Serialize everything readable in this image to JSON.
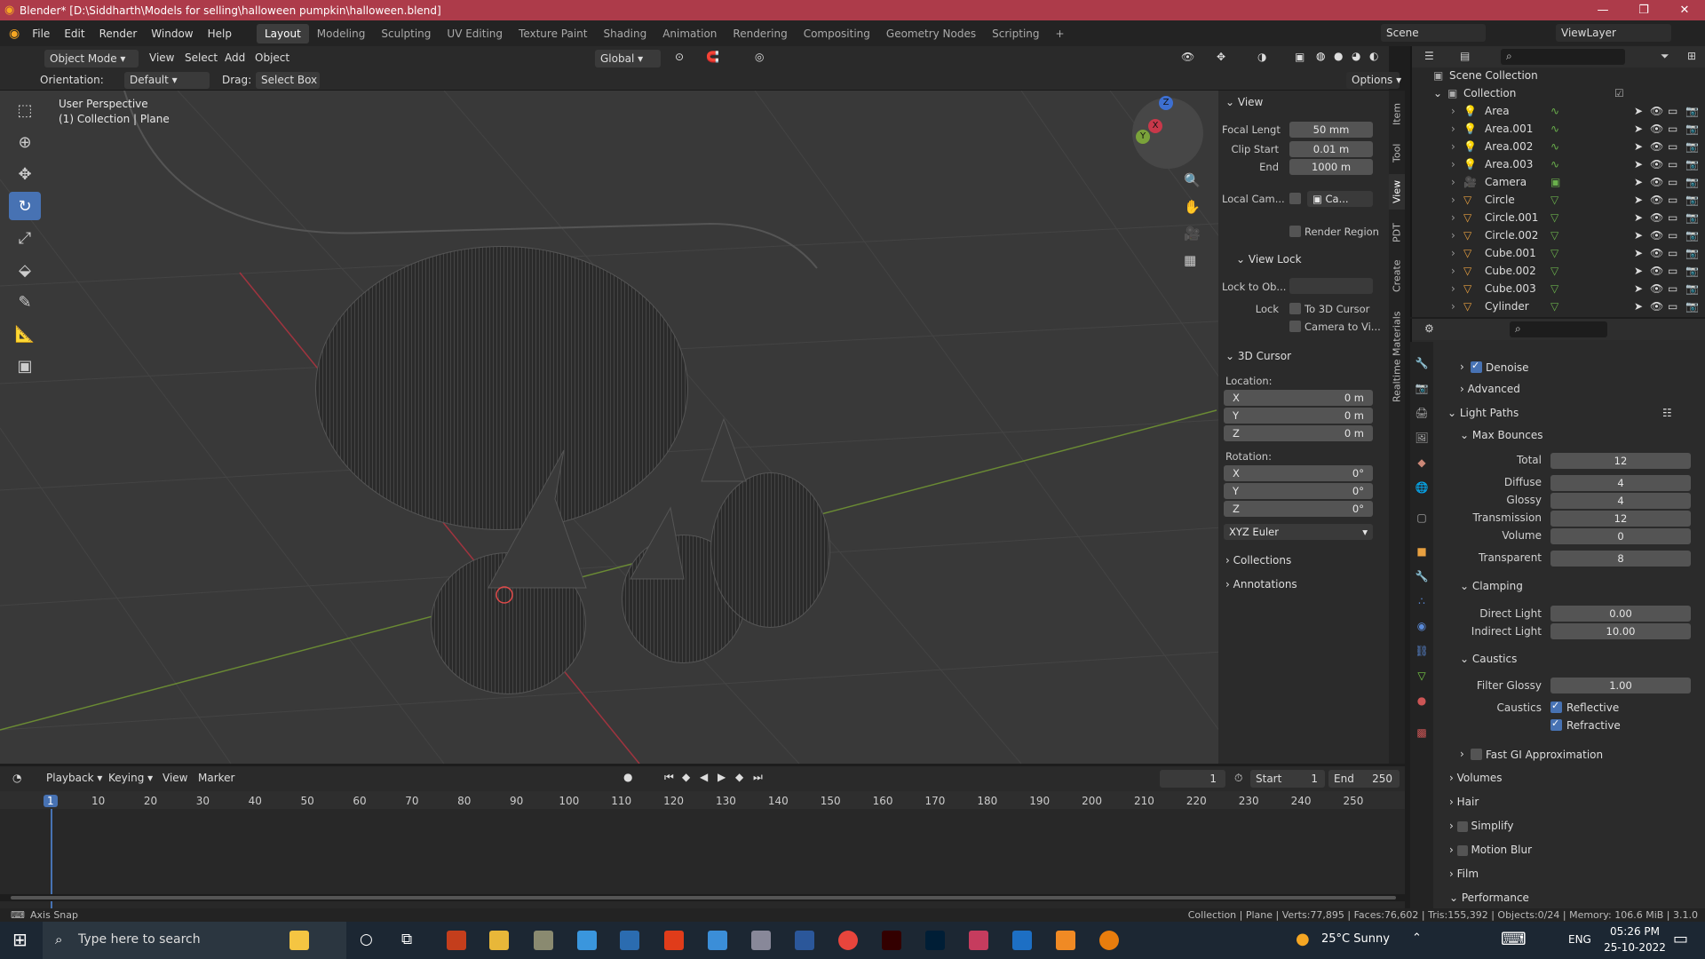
{
  "window": {
    "title": "Blender* [D:\\Siddharth\\Models for selling\\halloween pumpkin\\halloween.blend]",
    "min": "—",
    "max": "❐",
    "close": "✕"
  },
  "menu": {
    "items": [
      "File",
      "Edit",
      "Render",
      "Window",
      "Help"
    ],
    "workspaces": [
      "Layout",
      "Modeling",
      "Sculpting",
      "UV Editing",
      "Texture Paint",
      "Shading",
      "Animation",
      "Rendering",
      "Compositing",
      "Geometry Nodes",
      "Scripting",
      "+"
    ],
    "scene_label": "Scene",
    "viewlayer_label": "ViewLayer"
  },
  "viewport_header": {
    "mode": "Object Mode",
    "menus": [
      "View",
      "Select",
      "Add",
      "Object"
    ],
    "transform": "Global",
    "orientation_label": "Orientation:",
    "orientation_value": "Default",
    "drag_label": "Drag:",
    "drag_value": "Select Box",
    "options": "Options"
  },
  "viewport": {
    "perspective": "User Perspective",
    "collection": "(1) Collection | Plane",
    "gizmo": {
      "x": "X",
      "y": "Y",
      "z": "Z"
    }
  },
  "npanel": {
    "view_header": "View",
    "focal_label": "Focal Lengt",
    "focal_value": "50 mm",
    "clip_start_label": "Clip Start",
    "clip_start_value": "0.01 m",
    "end_label": "End",
    "end_value": "1000 m",
    "local_cam_label": "Local Cam...",
    "local_cam_value": "Ca...",
    "render_region": "Render Region",
    "view_lock_header": "View Lock",
    "lock_to_ob_label": "Lock to Ob...",
    "lock_label": "Lock",
    "to_3d_cursor": "To 3D Cursor",
    "camera_to_view": "Camera to Vi...",
    "cursor_header": "3D Cursor",
    "location_label": "Location:",
    "loc": [
      {
        "axis": "X",
        "value": "0 m"
      },
      {
        "axis": "Y",
        "value": "0 m"
      },
      {
        "axis": "Z",
        "value": "0 m"
      }
    ],
    "rotation_label": "Rotation:",
    "rot": [
      {
        "axis": "X",
        "value": "0°"
      },
      {
        "axis": "Y",
        "value": "0°"
      },
      {
        "axis": "Z",
        "value": "0°"
      }
    ],
    "rotation_mode": "XYZ Euler",
    "collections": "Collections",
    "annotations": "Annotations",
    "tabs": [
      "Item",
      "Tool",
      "View",
      "PDT",
      "Create",
      "Realtime Materials"
    ]
  },
  "outliner": {
    "root": "Scene Collection",
    "collection": "Collection",
    "items": [
      {
        "name": "Area",
        "kind": "light"
      },
      {
        "name": "Area.001",
        "kind": "light"
      },
      {
        "name": "Area.002",
        "kind": "light"
      },
      {
        "name": "Area.003",
        "kind": "light"
      },
      {
        "name": "Camera",
        "kind": "camera"
      },
      {
        "name": "Circle",
        "kind": "mesh"
      },
      {
        "name": "Circle.001",
        "kind": "mesh"
      },
      {
        "name": "Circle.002",
        "kind": "mesh"
      },
      {
        "name": "Cube.001",
        "kind": "mesh"
      },
      {
        "name": "Cube.002",
        "kind": "mesh"
      },
      {
        "name": "Cube.003",
        "kind": "mesh"
      },
      {
        "name": "Cylinder",
        "kind": "mesh"
      }
    ]
  },
  "properties": {
    "denoise": "Denoise",
    "advanced": "Advanced",
    "light_paths": "Light Paths",
    "max_bounces": "Max Bounces",
    "bounces": [
      {
        "label": "Total",
        "value": "12"
      },
      {
        "label": "Diffuse",
        "value": "4"
      },
      {
        "label": "Glossy",
        "value": "4"
      },
      {
        "label": "Transmission",
        "value": "12"
      },
      {
        "label": "Volume",
        "value": "0"
      },
      {
        "label": "Transparent",
        "value": "8"
      }
    ],
    "clamping": "Clamping",
    "direct_light_label": "Direct Light",
    "direct_light_value": "0.00",
    "indirect_light_label": "Indirect Light",
    "indirect_light_value": "10.00",
    "caustics_header": "Caustics",
    "filter_glossy_label": "Filter Glossy",
    "filter_glossy_value": "1.00",
    "caustics_label": "Caustics",
    "reflective": "Reflective",
    "refractive": "Refractive",
    "fast_gi": "Fast GI Approximation",
    "sections": [
      "Volumes",
      "Hair",
      "Simplify",
      "Motion Blur",
      "Film",
      "Performance"
    ]
  },
  "timeline": {
    "menus": [
      "Playback",
      "Keying",
      "View",
      "Marker"
    ],
    "current_frame": "1",
    "start_label": "Start",
    "start_value": "1",
    "end_label": "End",
    "end_value": "250",
    "ticks": [
      "1",
      "10",
      "20",
      "30",
      "40",
      "50",
      "60",
      "70",
      "80",
      "90",
      "100",
      "110",
      "120",
      "130",
      "140",
      "150",
      "160",
      "170",
      "180",
      "190",
      "200",
      "210",
      "220",
      "230",
      "240",
      "250"
    ]
  },
  "statusbar": {
    "left": "Axis Snap",
    "right": "Collection | Plane | Verts:77,895 | Faces:76,602 | Tris:155,392 | Objects:0/24 | Memory: 106.6 MiB | 3.1.0"
  },
  "taskbar": {
    "search_placeholder": "Type here to search",
    "weather": "25°C  Sunny",
    "lang": "ENG",
    "time": "05:26 PM",
    "date": "25-10-2022"
  },
  "colors": {
    "titlebar": "#ad3b4a",
    "accent": "#4772b3",
    "axis_x": "#c8384a",
    "axis_y": "#7aa23a"
  }
}
